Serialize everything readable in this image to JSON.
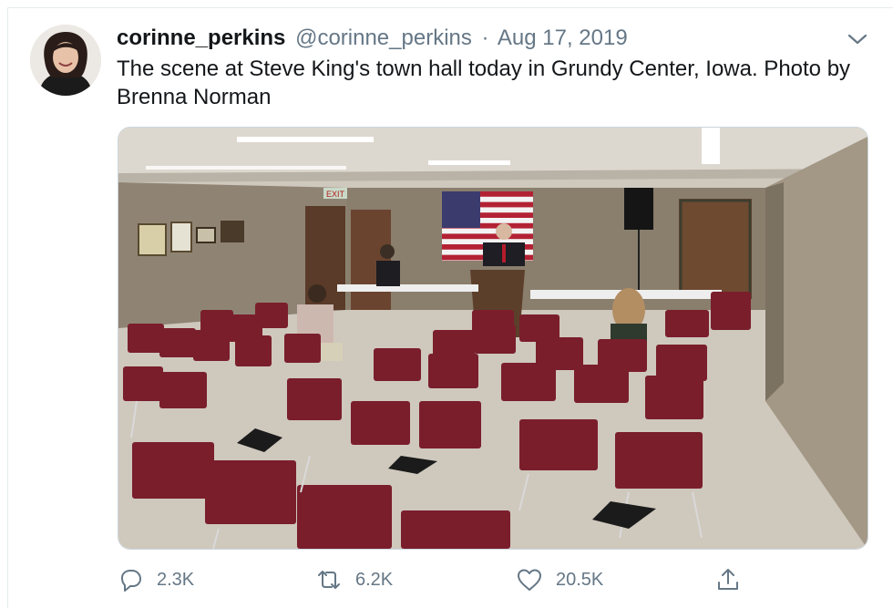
{
  "tweet": {
    "author_name": "corinne_perkins",
    "handle": "@corinne_perkins",
    "separator": "·",
    "date": "Aug 17, 2019",
    "text": "The scene at Steve King's town hall today in Grundy Center, Iowa. Photo by Brenna Norman"
  },
  "photo": {
    "exit_sign": "EXIT"
  },
  "actions": {
    "replies": "2.3K",
    "retweets": "6.2K",
    "likes": "20.5K"
  },
  "icons": {
    "more": "chevron-down-icon",
    "reply": "reply-icon",
    "retweet": "retweet-icon",
    "like": "heart-icon",
    "share": "share-icon"
  },
  "colors": {
    "text": "#14171a",
    "secondary": "#657786",
    "chair": "#7a1e2c",
    "wall": "#9c8f7e"
  }
}
